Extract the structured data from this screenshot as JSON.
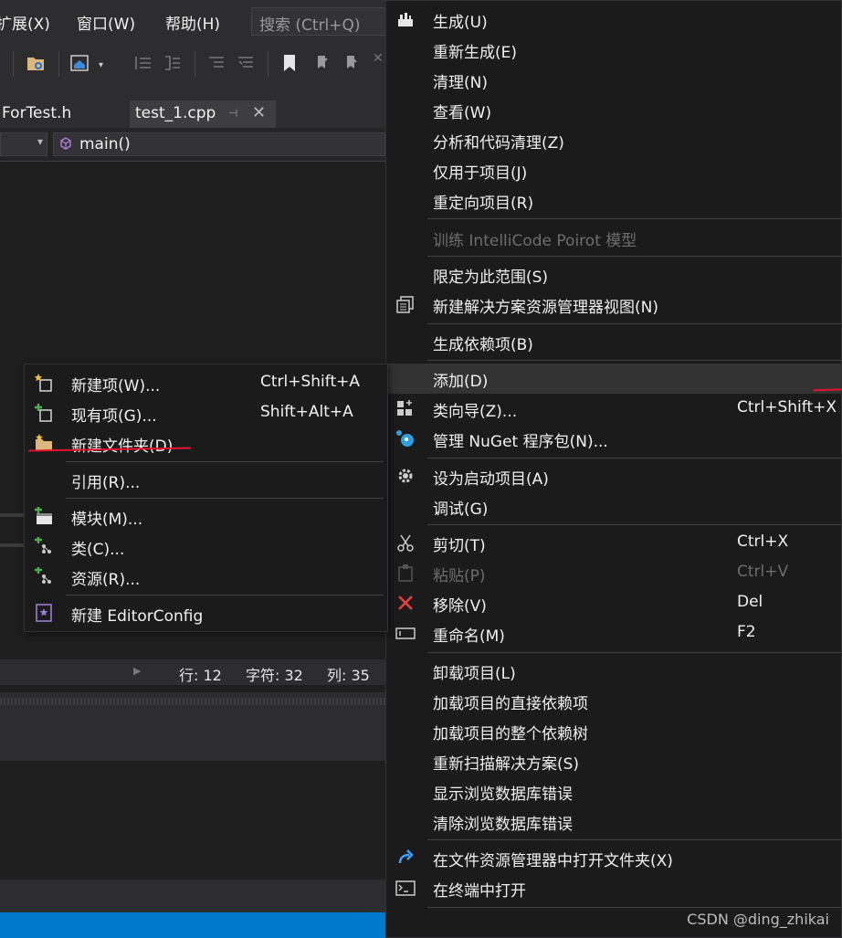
{
  "menubar": {
    "items": [
      "扩展(X)",
      "窗口(W)",
      "帮助(H)"
    ],
    "search_placeholder": "搜索 (Ctrl+Q)"
  },
  "tabs": {
    "inactive_label": "ForTest.h",
    "active_label": "test_1.cpp"
  },
  "navbar": {
    "member": "main()"
  },
  "status": {
    "line": "行: 12",
    "char": "字符: 32",
    "col": "列: 35"
  },
  "context_menu": {
    "build": "生成(U)",
    "rebuild": "重新生成(E)",
    "clean": "清理(N)",
    "view": "查看(W)",
    "analyze": "分析和代码清理(Z)",
    "project_only": "仅用于项目(J)",
    "retarget": "重定向项目(R)",
    "train": "训练 IntelliCode Poirot 模型",
    "scope": "限定为此范围(S)",
    "new_view": "新建解决方案资源管理器视图(N)",
    "build_deps": "生成依赖项(B)",
    "add": "添加(D)",
    "class_wizard": "类向导(Z)...",
    "class_wizard_shortcut": "Ctrl+Shift+X",
    "nuget": "管理 NuGet 程序包(N)...",
    "set_startup": "设为启动项目(A)",
    "debug": "调试(G)",
    "cut": "剪切(T)",
    "cut_shortcut": "Ctrl+X",
    "paste": "粘贴(P)",
    "paste_shortcut": "Ctrl+V",
    "remove": "移除(V)",
    "remove_shortcut": "Del",
    "rename": "重命名(M)",
    "rename_shortcut": "F2",
    "unload": "卸载项目(L)",
    "load_direct": "加载项目的直接依赖项",
    "load_tree": "加载项目的整个依赖树",
    "rescan": "重新扫描解决方案(S)",
    "show_db_errors": "显示浏览数据库错误",
    "clear_db_errors": "清除浏览数据库错误",
    "open_in_explorer": "在文件资源管理器中打开文件夹(X)",
    "open_in_terminal": "在终端中打开"
  },
  "add_submenu": {
    "new_item": "新建项(W)...",
    "new_item_shortcut": "Ctrl+Shift+A",
    "existing_item": "现有项(G)...",
    "existing_item_shortcut": "Shift+Alt+A",
    "new_folder": "新建文件夹(D)",
    "reference": "引用(R)...",
    "module": "模块(M)...",
    "class": "类(C)...",
    "resource": "资源(R)...",
    "editorconfig": "新建 EditorConfig"
  },
  "watermark": "CSDN @ding_zhikai",
  "colors": {
    "menu_bg": "#1b1b1c",
    "highlight": "#333334",
    "annotation_red": "#e8112d",
    "status_blue": "#007acc"
  }
}
